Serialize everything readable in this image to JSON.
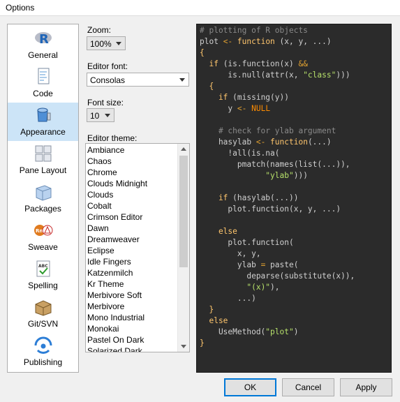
{
  "window": {
    "title": "Options"
  },
  "sidebar": {
    "items": [
      {
        "label": "General",
        "icon": "r-logo-icon",
        "selected": false
      },
      {
        "label": "Code",
        "icon": "code-document-icon",
        "selected": false
      },
      {
        "label": "Appearance",
        "icon": "paint-bucket-icon",
        "selected": true
      },
      {
        "label": "Pane Layout",
        "icon": "pane-layout-icon",
        "selected": false
      },
      {
        "label": "Packages",
        "icon": "packages-icon",
        "selected": false
      },
      {
        "label": "Sweave",
        "icon": "sweave-icon",
        "selected": false
      },
      {
        "label": "Spelling",
        "icon": "spelling-icon",
        "selected": false
      },
      {
        "label": "Git/SVN",
        "icon": "git-svn-icon",
        "selected": false
      },
      {
        "label": "Publishing",
        "icon": "publishing-icon",
        "selected": false
      }
    ]
  },
  "appearance": {
    "zoom_label": "Zoom:",
    "zoom_value": "100%",
    "font_label": "Editor font:",
    "font_value": "Consolas",
    "fontsize_label": "Font size:",
    "fontsize_value": "10",
    "theme_label": "Editor theme:",
    "themes": [
      "Ambiance",
      "Chaos",
      "Chrome",
      "Clouds Midnight",
      "Clouds",
      "Cobalt",
      "Crimson Editor",
      "Dawn",
      "Dreamweaver",
      "Eclipse",
      "Idle Fingers",
      "Katzenmilch",
      "Kr Theme",
      "Merbivore Soft",
      "Merbivore",
      "Mono Industrial",
      "Monokai",
      "Pastel On Dark",
      "Solarized Dark"
    ]
  },
  "preview": {
    "lines": [
      [
        {
          "t": "# plotting of R objects",
          "c": "com"
        }
      ],
      [
        {
          "t": "plot ",
          "c": "fn"
        },
        {
          "t": "<-",
          "c": "op"
        },
        {
          "t": " function",
          "c": "kw"
        },
        {
          "t": " (x, y, ...)",
          "c": "fn"
        }
      ],
      [
        {
          "t": "{",
          "c": "kw"
        }
      ],
      [
        {
          "t": "  if",
          "c": "kw"
        },
        {
          "t": " (is.function(x) ",
          "c": "fn"
        },
        {
          "t": "&&",
          "c": "op"
        }
      ],
      [
        {
          "t": "      is.null(attr(x, ",
          "c": "fn"
        },
        {
          "t": "\"class\"",
          "c": "str"
        },
        {
          "t": ")))",
          "c": "fn"
        }
      ],
      [
        {
          "t": "  {",
          "c": "kw"
        }
      ],
      [
        {
          "t": "    if",
          "c": "kw"
        },
        {
          "t": " (missing(y))",
          "c": "fn"
        }
      ],
      [
        {
          "t": "      y ",
          "c": "fn"
        },
        {
          "t": "<-",
          "c": "op"
        },
        {
          "t": " NULL",
          "c": "const"
        }
      ],
      [
        {
          "t": "",
          "c": "fn"
        }
      ],
      [
        {
          "t": "    # check for ylab argument",
          "c": "com"
        }
      ],
      [
        {
          "t": "    hasylab ",
          "c": "fn"
        },
        {
          "t": "<-",
          "c": "op"
        },
        {
          "t": " function",
          "c": "kw"
        },
        {
          "t": "(...)",
          "c": "fn"
        }
      ],
      [
        {
          "t": "      !all(is.na(",
          "c": "fn"
        }
      ],
      [
        {
          "t": "        pmatch(names(list(...)),",
          "c": "fn"
        }
      ],
      [
        {
          "t": "              ",
          "c": "fn"
        },
        {
          "t": "\"ylab\"",
          "c": "str"
        },
        {
          "t": ")))",
          "c": "fn"
        }
      ],
      [
        {
          "t": "",
          "c": "fn"
        }
      ],
      [
        {
          "t": "    if",
          "c": "kw"
        },
        {
          "t": " (hasylab(...))",
          "c": "fn"
        }
      ],
      [
        {
          "t": "      plot.function(x, y, ...)",
          "c": "fn"
        }
      ],
      [
        {
          "t": "",
          "c": "fn"
        }
      ],
      [
        {
          "t": "    else",
          "c": "kw"
        }
      ],
      [
        {
          "t": "      plot.function(",
          "c": "fn"
        }
      ],
      [
        {
          "t": "        x, y,",
          "c": "fn"
        }
      ],
      [
        {
          "t": "        ylab ",
          "c": "fn"
        },
        {
          "t": "=",
          "c": "op"
        },
        {
          "t": " paste(",
          "c": "fn"
        }
      ],
      [
        {
          "t": "          deparse(substitute(x)),",
          "c": "fn"
        }
      ],
      [
        {
          "t": "          ",
          "c": "fn"
        },
        {
          "t": "\"(x)\"",
          "c": "str"
        },
        {
          "t": "),",
          "c": "fn"
        }
      ],
      [
        {
          "t": "        ...)",
          "c": "fn"
        }
      ],
      [
        {
          "t": "  }",
          "c": "kw"
        }
      ],
      [
        {
          "t": "  else",
          "c": "kw"
        }
      ],
      [
        {
          "t": "    UseMethod(",
          "c": "fn"
        },
        {
          "t": "\"plot\"",
          "c": "str"
        },
        {
          "t": ")",
          "c": "fn"
        }
      ],
      [
        {
          "t": "}",
          "c": "kw"
        }
      ]
    ]
  },
  "buttons": {
    "ok": "OK",
    "cancel": "Cancel",
    "apply": "Apply"
  },
  "colors": {
    "selected_bg": "#cce4f7",
    "editor_bg": "#2b2b2b",
    "default_button_border": "#0078d7"
  }
}
